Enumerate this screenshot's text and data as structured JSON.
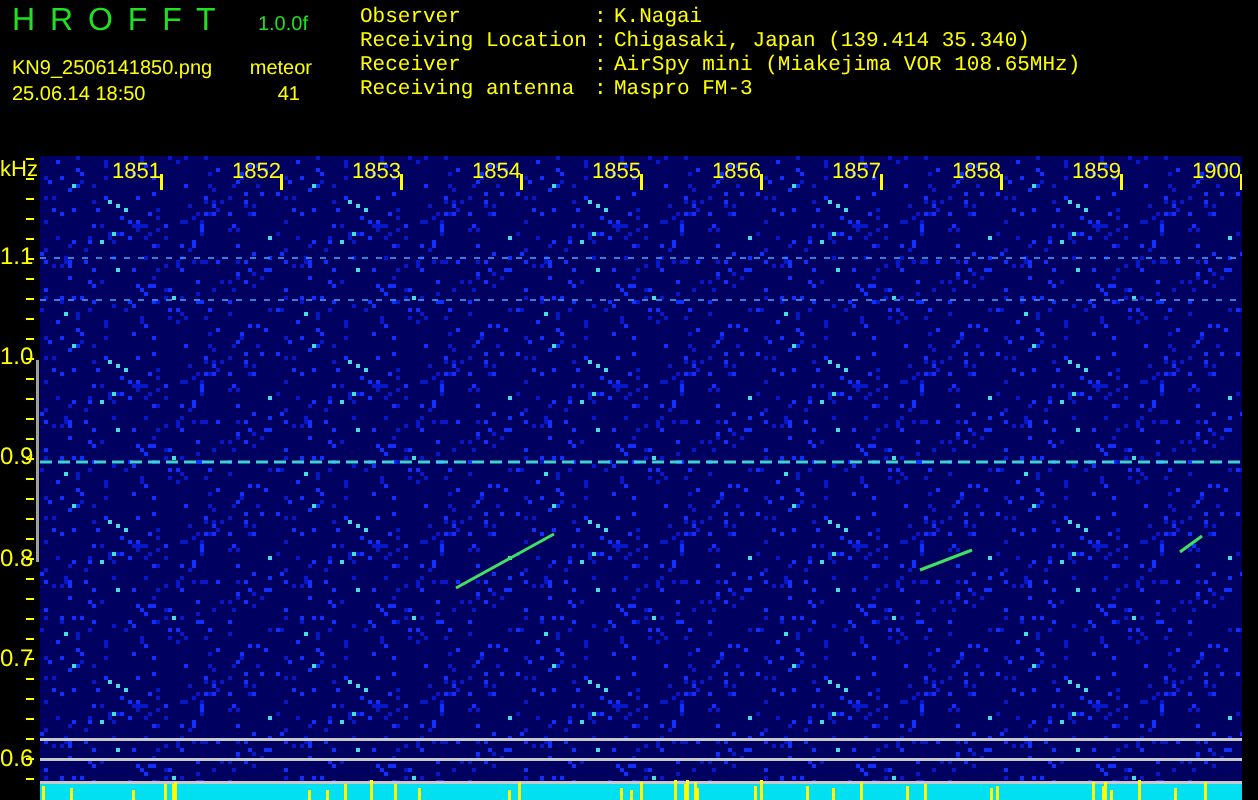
{
  "app": {
    "name": "H R O F F T",
    "version": "1.0.0f",
    "filename": "KN9_2506141850.png",
    "datetime": "25.06.14 18:50",
    "count_label": "meteor",
    "count": "41"
  },
  "info": {
    "separator": ":",
    "rows": [
      {
        "label": "Observer",
        "value": "K.Nagai"
      },
      {
        "label": "Receiving Location",
        "value": "Chigasaki, Japan (139.414 35.340)"
      },
      {
        "label": "Receiver",
        "value": "AirSpy mini (Miakejima VOR 108.65MHz)"
      },
      {
        "label": "Receiving antenna",
        "value": "Maspro FM-3"
      }
    ]
  },
  "spectrogram": {
    "y_unit": "kHz",
    "time_labels": [
      "1851",
      "1852",
      "1853",
      "1854",
      "1855",
      "1856",
      "1857",
      "1858",
      "1859",
      "1900"
    ],
    "freq_labels": [
      "1.1",
      "1.0",
      "0.9",
      "0.8",
      "0.7",
      "0.6"
    ]
  }
}
